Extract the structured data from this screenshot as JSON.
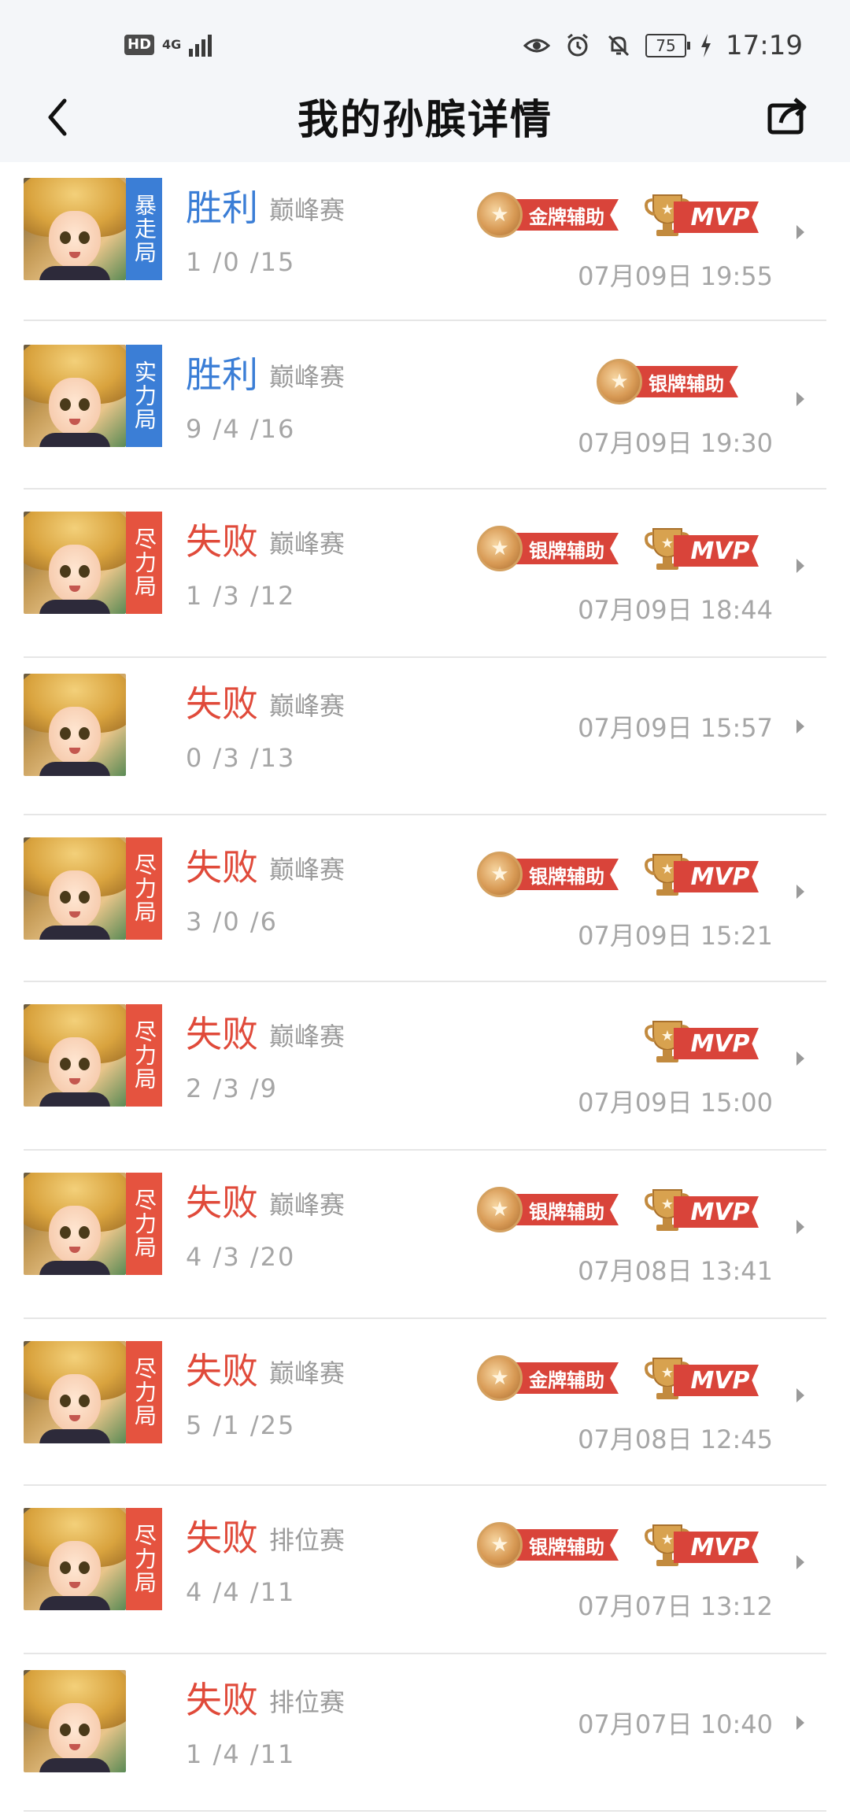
{
  "status_bar": {
    "hd": "HD",
    "network": "4G",
    "battery": "75",
    "time": "17:19"
  },
  "header": {
    "title": "我的孙膑详情"
  },
  "matches": [
    {
      "tag": "暴走局",
      "tag_color": "blue",
      "result": "胜利",
      "result_type": "win",
      "mode": "巅峰赛",
      "kda": "1 /0 /15",
      "datetime": "07月09日 19:55",
      "assist_badge": "金牌辅助",
      "mvp": "MVP"
    },
    {
      "tag": "实力局",
      "tag_color": "blue",
      "result": "胜利",
      "result_type": "win",
      "mode": "巅峰赛",
      "kda": "9 /4 /16",
      "datetime": "07月09日 19:30",
      "assist_badge": "银牌辅助",
      "mvp": ""
    },
    {
      "tag": "尽力局",
      "tag_color": "red",
      "result": "失败",
      "result_type": "lose",
      "mode": "巅峰赛",
      "kda": "1 /3 /12",
      "datetime": "07月09日 18:44",
      "assist_badge": "银牌辅助",
      "mvp": "MVP"
    },
    {
      "tag": "",
      "tag_color": "",
      "result": "失败",
      "result_type": "lose",
      "mode": "巅峰赛",
      "kda": "0 /3 /13",
      "datetime": "07月09日 15:57",
      "assist_badge": "",
      "mvp": ""
    },
    {
      "tag": "尽力局",
      "tag_color": "red",
      "result": "失败",
      "result_type": "lose",
      "mode": "巅峰赛",
      "kda": "3 /0 /6",
      "datetime": "07月09日 15:21",
      "assist_badge": "银牌辅助",
      "mvp": "MVP"
    },
    {
      "tag": "尽力局",
      "tag_color": "red",
      "result": "失败",
      "result_type": "lose",
      "mode": "巅峰赛",
      "kda": "2 /3 /9",
      "datetime": "07月09日 15:00",
      "assist_badge": "",
      "mvp": "MVP"
    },
    {
      "tag": "尽力局",
      "tag_color": "red",
      "result": "失败",
      "result_type": "lose",
      "mode": "巅峰赛",
      "kda": "4 /3 /20",
      "datetime": "07月08日 13:41",
      "assist_badge": "银牌辅助",
      "mvp": "MVP"
    },
    {
      "tag": "尽力局",
      "tag_color": "red",
      "result": "失败",
      "result_type": "lose",
      "mode": "巅峰赛",
      "kda": "5 /1 /25",
      "datetime": "07月08日 12:45",
      "assist_badge": "金牌辅助",
      "mvp": "MVP"
    },
    {
      "tag": "尽力局",
      "tag_color": "red",
      "result": "失败",
      "result_type": "lose",
      "mode": "排位赛",
      "kda": "4 /4 /11",
      "datetime": "07月07日 13:12",
      "assist_badge": "银牌辅助",
      "mvp": "MVP"
    },
    {
      "tag": "",
      "tag_color": "",
      "result": "失败",
      "result_type": "lose",
      "mode": "排位赛",
      "kda": "1 /4 /11",
      "datetime": "07月07日 10:40",
      "assist_badge": "",
      "mvp": ""
    }
  ],
  "colors": {
    "win": "#3b7ed6",
    "lose": "#e04a3a",
    "tag_blue": "#3b7ed6",
    "tag_red": "#e5533f",
    "badge_red": "#d9443a"
  },
  "icons": {
    "back": "chevron-left-icon",
    "share": "share-icon",
    "row_arrow": "chevron-right-icon"
  }
}
